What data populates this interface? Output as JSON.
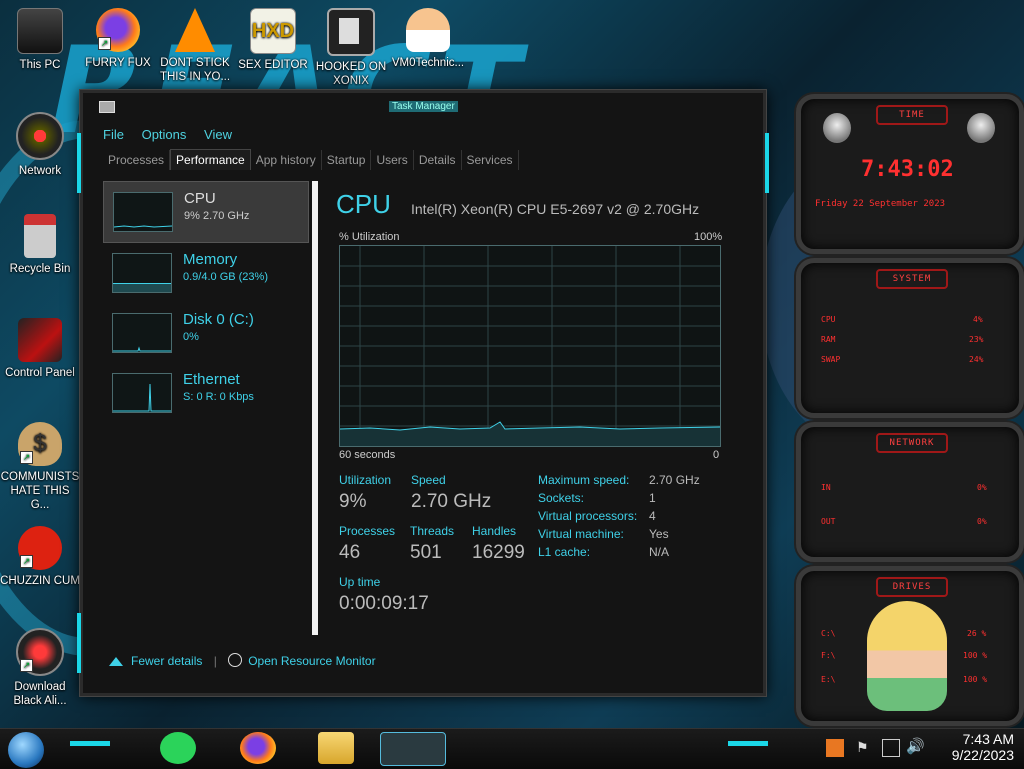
{
  "desktop": {
    "top_icons": [
      {
        "label": "This PC"
      },
      {
        "label": "FURRY FUX"
      },
      {
        "label": "DONT STICK THIS IN YO..."
      },
      {
        "label": "SEX EDITOR"
      },
      {
        "label": "HOOKED ON XONIX"
      },
      {
        "label": "VM0Technic..."
      }
    ],
    "left_icons": [
      {
        "label": "Network"
      },
      {
        "label": "Recycle Bin"
      },
      {
        "label": "Control Panel"
      },
      {
        "label": "COMMUNISTS HATE THIS G..."
      },
      {
        "label": "CHUZZIN CUM"
      },
      {
        "label": "Download Black Ali..."
      }
    ]
  },
  "task_manager": {
    "title": "Task Manager",
    "menu": [
      "File",
      "Options",
      "View"
    ],
    "tabs": [
      "Processes",
      "Performance",
      "App history",
      "Startup",
      "Users",
      "Details",
      "Services"
    ],
    "active_tab": "Performance",
    "resources": [
      {
        "name": "CPU",
        "value": "9% 2.70 GHz"
      },
      {
        "name": "Memory",
        "value": "0.9/4.0 GB (23%)"
      },
      {
        "name": "Disk 0 (C:)",
        "value": "0%"
      },
      {
        "name": "Ethernet",
        "value": "S: 0 R: 0 Kbps"
      }
    ],
    "cpu": {
      "title": "CPU",
      "model": "Intel(R) Xeon(R) CPU E5-2697 v2 @ 2.70GHz",
      "util_label": "% Utilization",
      "max_label": "100%",
      "time_label": "60 seconds",
      "zero_label": "0",
      "stats": {
        "utilization_label": "Utilization",
        "utilization": "9%",
        "speed_label": "Speed",
        "speed": "2.70 GHz",
        "processes_label": "Processes",
        "processes": "46",
        "threads_label": "Threads",
        "threads": "501",
        "handles_label": "Handles",
        "handles": "16299",
        "uptime_label": "Up time",
        "uptime": "0:00:09:17"
      },
      "details": [
        {
          "k": "Maximum speed:",
          "v": "2.70 GHz"
        },
        {
          "k": "Sockets:",
          "v": "1"
        },
        {
          "k": "Virtual processors:",
          "v": "4"
        },
        {
          "k": "Virtual machine:",
          "v": "Yes"
        },
        {
          "k": "L1 cache:",
          "v": "N/A"
        }
      ]
    },
    "footer": {
      "fewer": "Fewer details",
      "monitor": "Open Resource Monitor"
    }
  },
  "widgets": {
    "time": {
      "header": "TIME",
      "clock": "7:43:02",
      "date": "Friday 22 September 2023"
    },
    "system": {
      "header": "SYSTEM",
      "rows": [
        {
          "k": "CPU",
          "v": "4%"
        },
        {
          "k": "RAM",
          "v": "23%"
        },
        {
          "k": "SWAP",
          "v": "24%"
        }
      ]
    },
    "network": {
      "header": "NETWORK",
      "rows": [
        {
          "k": "IN",
          "v": "0%"
        },
        {
          "k": "OUT",
          "v": "0%"
        }
      ]
    },
    "drives": {
      "header": "DRIVES",
      "rows": [
        {
          "k": "C:\\",
          "v": "26 %"
        },
        {
          "k": "F:\\",
          "v": "100 %"
        },
        {
          "k": "E:\\",
          "v": "100 %"
        }
      ]
    }
  },
  "taskbar": {
    "time": "7:43 AM",
    "date": "9/22/2023"
  },
  "colors": {
    "accent": "#3fd1e8",
    "widget_red": "#ff3030"
  }
}
